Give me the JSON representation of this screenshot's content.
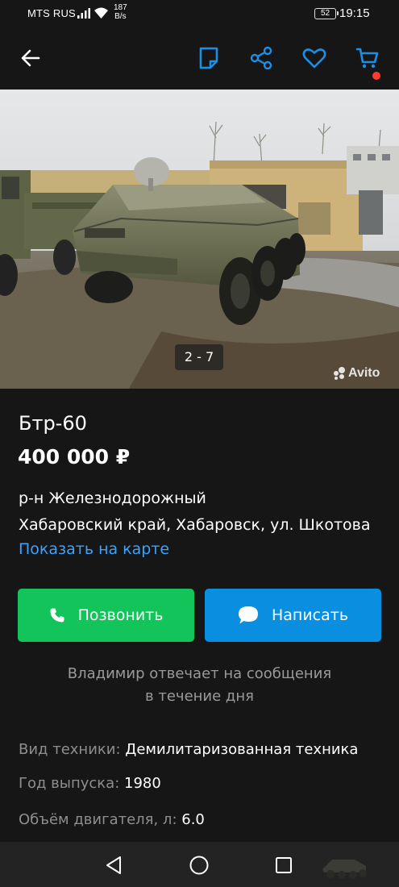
{
  "status_bar": {
    "carrier": "MTS RUS",
    "speed_value": "187",
    "speed_unit": "B/s",
    "battery": "52",
    "time": "19:15"
  },
  "toolbar": {
    "icons": [
      "back-arrow-icon",
      "note-icon",
      "share-icon",
      "heart-icon",
      "cart-icon"
    ],
    "accent_color": "#1a8fe6",
    "cart_badge_color": "#ff3b30"
  },
  "photo": {
    "counter": "2 - 7",
    "watermark": "Avito"
  },
  "listing": {
    "title": "Бтр-60",
    "price": "400 000 ₽",
    "district": "р-н Железнодорожный",
    "address": "Хабаровский край, Хабаровск, ул. Шкотова",
    "map_link": "Показать на карте"
  },
  "actions": {
    "call_label": "Позвонить",
    "write_label": "Написать",
    "call_color": "#12c45a",
    "write_color": "#0a8fe0"
  },
  "seller": {
    "reply_line1": "Владимир отвечает на сообщения",
    "reply_line2": "в течение дня"
  },
  "params": [
    {
      "key": "Вид техники:",
      "value": "Демилитаризованная техника"
    },
    {
      "key": "Год выпуска:",
      "value": "1980"
    },
    {
      "key": "Объём двигателя, л:",
      "value": "6.0"
    }
  ],
  "nav_bar": {
    "icons": [
      "nav-back-icon",
      "nav-home-icon",
      "nav-recent-icon"
    ]
  }
}
